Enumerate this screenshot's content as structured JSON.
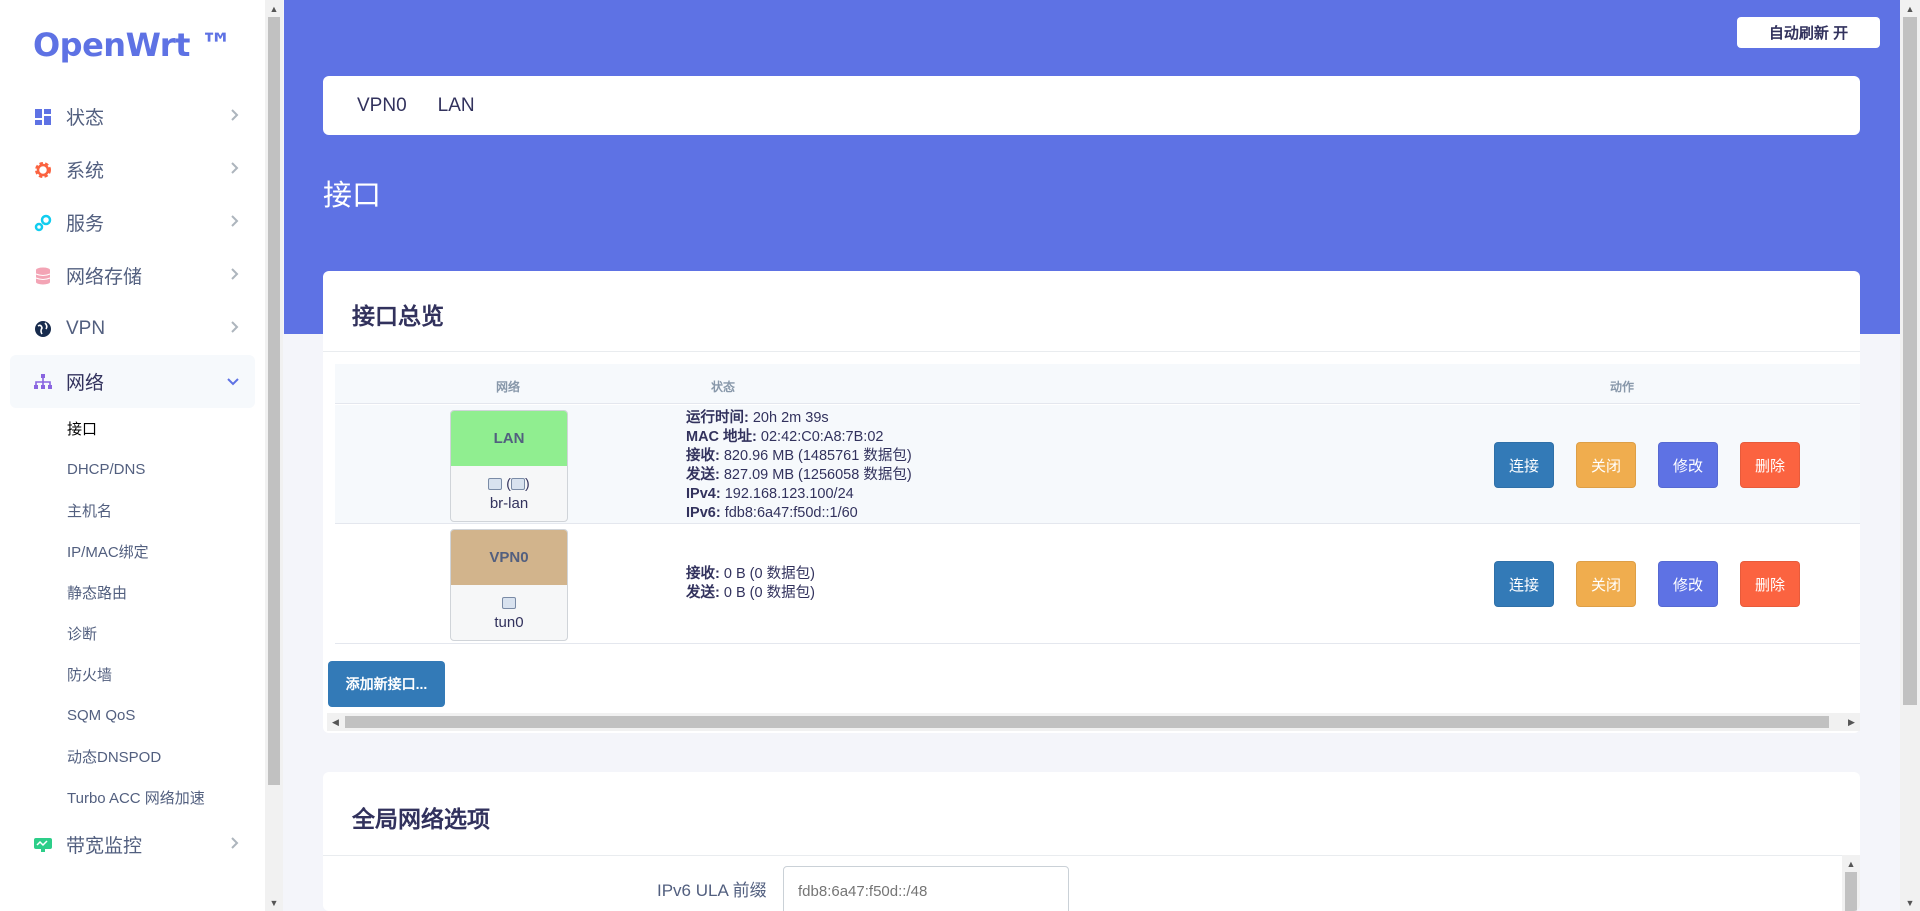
{
  "brand": {
    "name": "OpenWrt ™"
  },
  "sidebar": {
    "items": [
      {
        "label": "状态",
        "icon": "dashboard-icon"
      },
      {
        "label": "系统",
        "icon": "gear-icon"
      },
      {
        "label": "服务",
        "icon": "services-icon"
      },
      {
        "label": "网络存储",
        "icon": "database-icon"
      },
      {
        "label": "VPN",
        "icon": "globe-icon"
      },
      {
        "label": "网络",
        "icon": "network-icon",
        "expanded": true
      },
      {
        "label": "带宽监控",
        "icon": "monitor-icon"
      }
    ],
    "submenu": [
      {
        "label": "接口",
        "current": true
      },
      {
        "label": "DHCP/DNS"
      },
      {
        "label": "主机名"
      },
      {
        "label": "IP/MAC绑定"
      },
      {
        "label": "静态路由"
      },
      {
        "label": "诊断"
      },
      {
        "label": "防火墙"
      },
      {
        "label": "SQM QoS"
      },
      {
        "label": "动态DNSPOD"
      },
      {
        "label": "Turbo ACC 网络加速"
      }
    ]
  },
  "header": {
    "refresh_label": "自动刷新 开",
    "tabs": [
      {
        "label": "VPN0"
      },
      {
        "label": "LAN"
      }
    ],
    "page_title": "接口"
  },
  "overview": {
    "title": "接口总览",
    "columns": {
      "network": "网络",
      "status": "状态",
      "actions": "动作"
    },
    "rows": [
      {
        "name": "LAN",
        "color": "#90ee90",
        "device_line": "(",
        "device_line_end": ")",
        "device": "br-lan",
        "status": [
          {
            "k": "运行时间:",
            "v": " 20h 2m 39s"
          },
          {
            "k": "MAC 地址:",
            "v": " 02:42:C0:A8:7B:02"
          },
          {
            "k": "接收:",
            "v": " 820.96 MB (1485761 数据包)"
          },
          {
            "k": "发送:",
            "v": " 827.09 MB (1256058 数据包)"
          },
          {
            "k": "IPv4:",
            "v": " 192.168.123.100/24"
          },
          {
            "k": "IPv6:",
            "v": " fdb8:6a47:f50d::1/60"
          }
        ]
      },
      {
        "name": "VPN0",
        "color": "#d2b48c",
        "device": "tun0",
        "status": [
          {
            "k": "接收:",
            "v": " 0 B (0 数据包)"
          },
          {
            "k": "发送:",
            "v": " 0 B (0 数据包)"
          }
        ]
      }
    ],
    "actions": {
      "connect": "连接",
      "close": "关闭",
      "edit": "修改",
      "delete": "删除"
    },
    "add_label": "添加新接口..."
  },
  "global": {
    "title": "全局网络选项",
    "ula_label": "IPv6 ULA 前缀",
    "ula_value": "fdb8:6a47:f50d::/48"
  },
  "colors": {
    "primary": "#5e72e4",
    "connect": "#337ab7",
    "close": "#f0ad4e",
    "delete": "#fb6340",
    "lan": "#90ee90",
    "vpn": "#d2b48c"
  }
}
